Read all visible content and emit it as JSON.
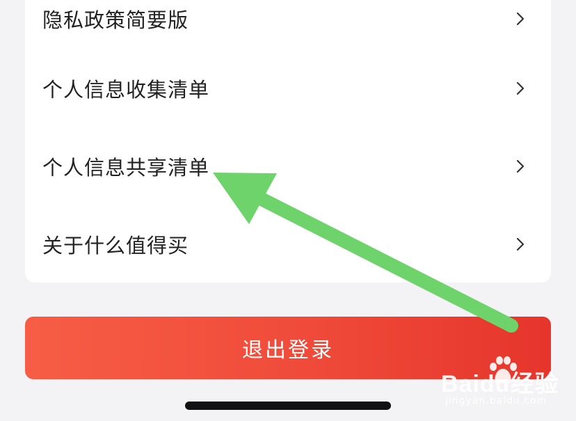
{
  "menu": {
    "items": [
      {
        "label": "隐私政策简要版"
      },
      {
        "label": "个人信息收集清单"
      },
      {
        "label": "个人信息共享清单"
      },
      {
        "label": "关于什么值得买"
      }
    ]
  },
  "logout": {
    "label": "退出登录"
  },
  "watermark": {
    "brand": "Baidu经验",
    "url": "jingyan.baidu.com"
  },
  "colors": {
    "background": "#f3f3f5",
    "card": "#ffffff",
    "logout_start": "#f75d45",
    "logout_end": "#e6352c",
    "arrow": "#6dd36a"
  },
  "icons": {
    "row_chevron": "chevron-right-icon",
    "annotation": "arrow-annotation"
  }
}
